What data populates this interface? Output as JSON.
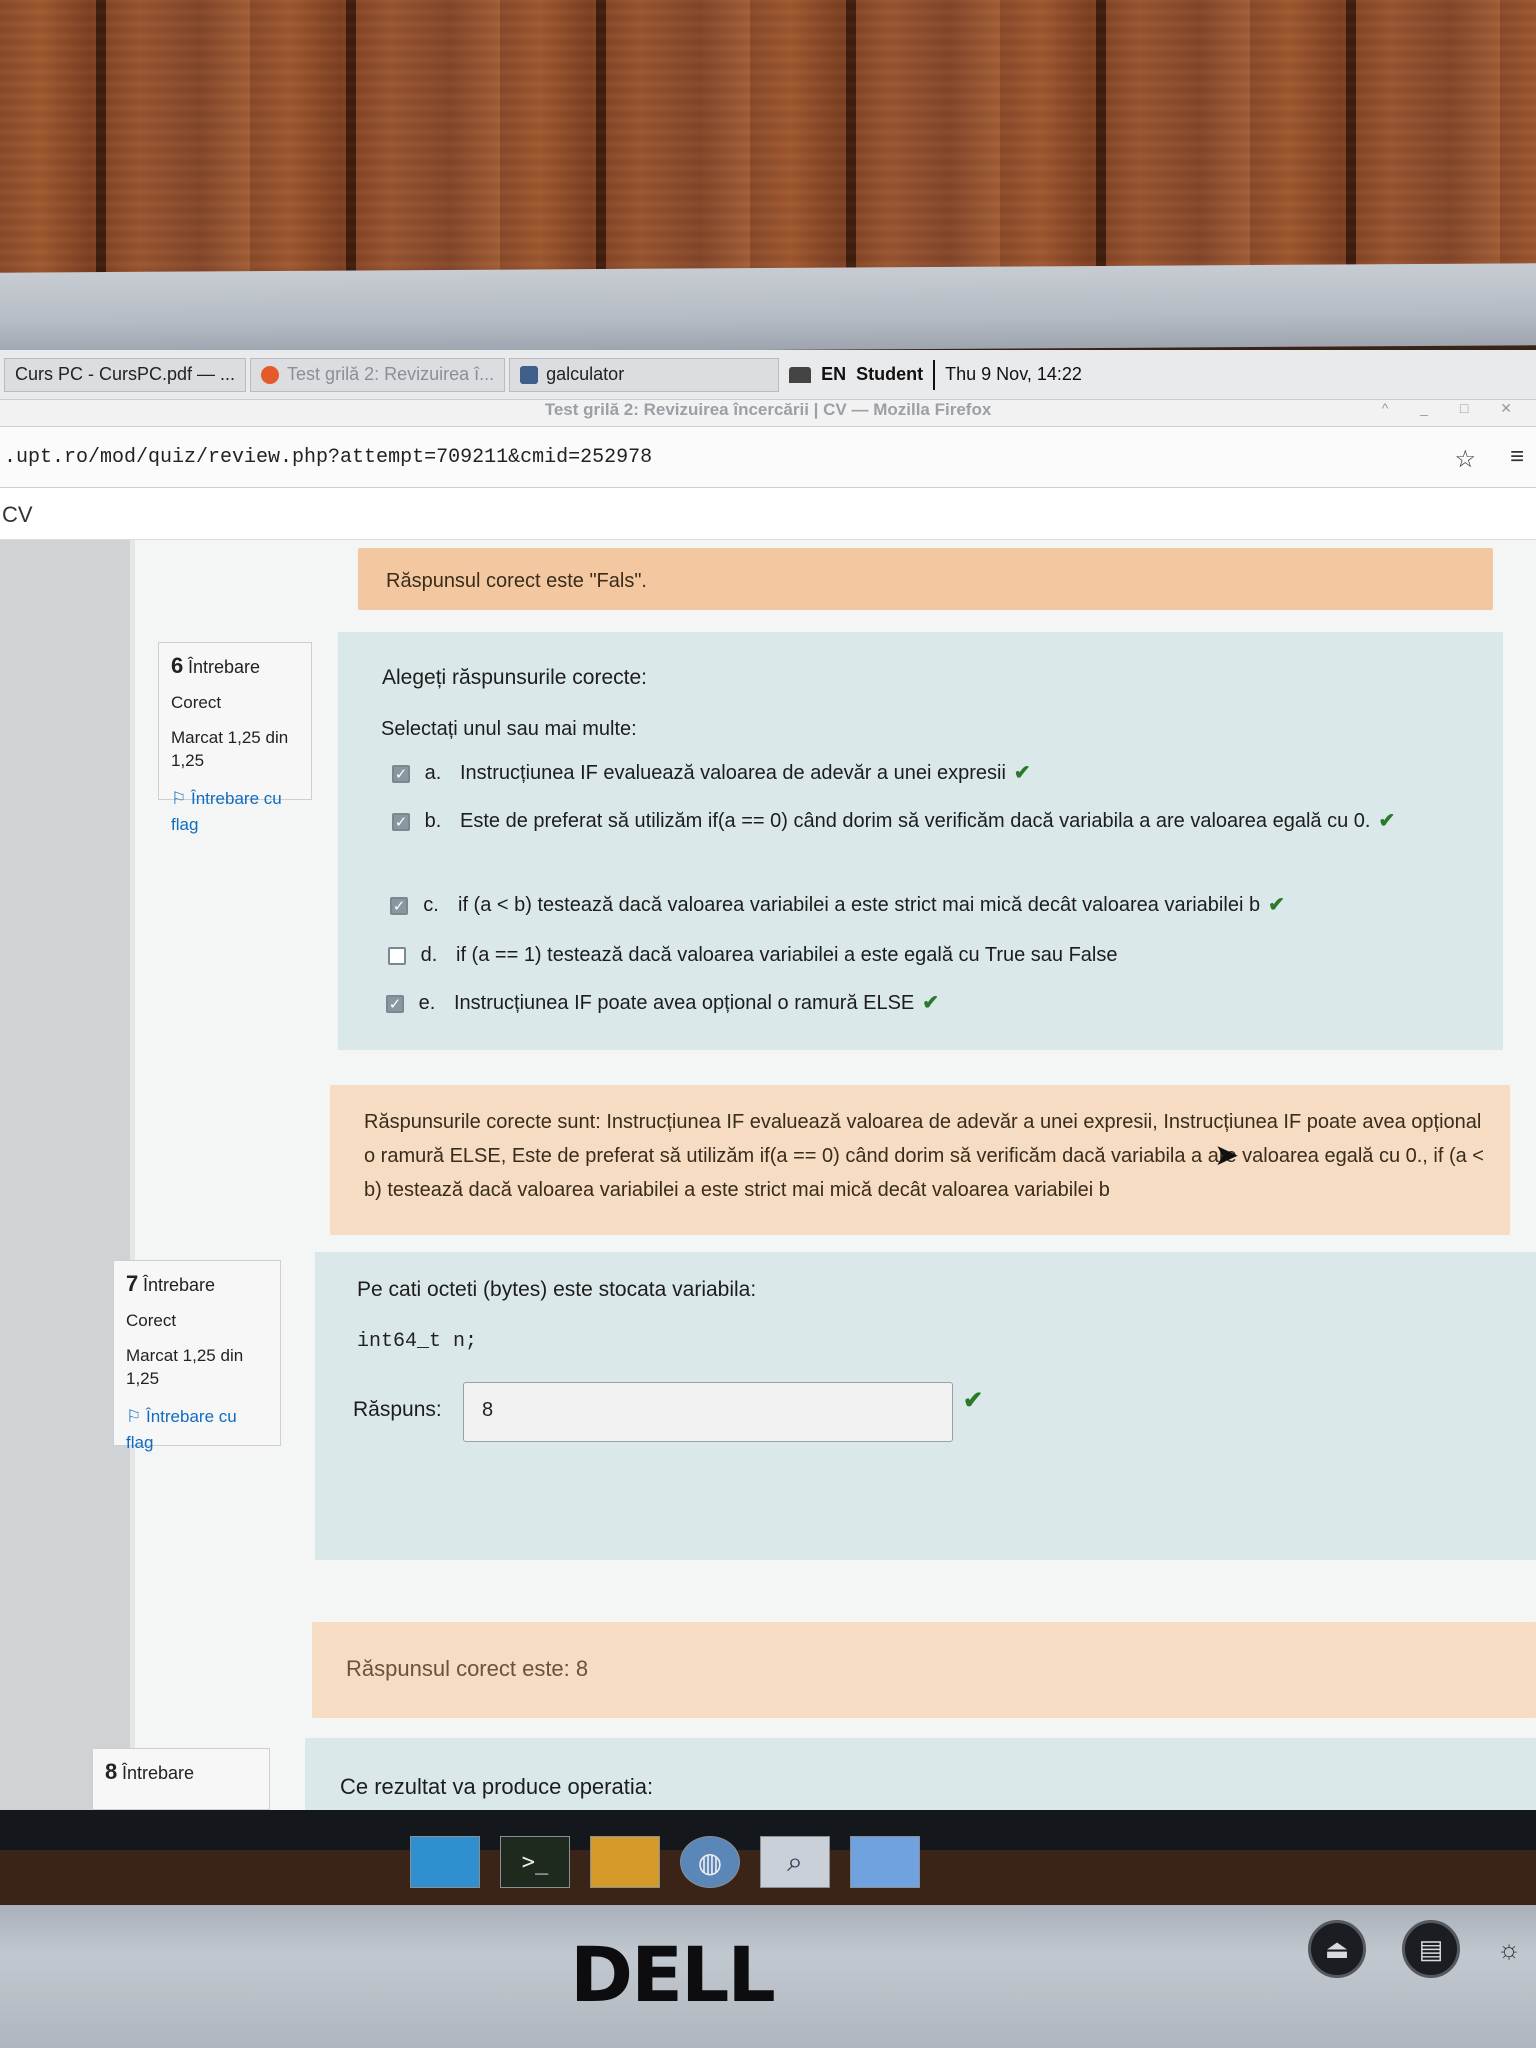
{
  "taskbar": {
    "tasks": [
      {
        "label": "Curs PC - CursPC.pdf — ..."
      },
      {
        "label": "Test grilă 2: Revizuirea î..."
      },
      {
        "label": "galculator"
      }
    ],
    "keyboard_layout": "EN",
    "user": "Student",
    "datetime": "Thu  9 Nov, 14:22"
  },
  "window": {
    "title": "Test grilă 2: Revizuirea încercării | CV — Mozilla Firefox"
  },
  "browser": {
    "url": ".upt.ro/mod/quiz/review.php?attempt=709211&cmid=252978",
    "breadcrumb": "CV"
  },
  "prev_feedback": "Răspunsul corect este \"Fals\".",
  "q6": {
    "number": "6",
    "word": "Întrebare",
    "status": "Corect",
    "mark": "Marcat 1,25 din 1,25",
    "flag": "Întrebare cu flag",
    "prompt": "Alegeți răspunsurile corecte:",
    "instruction": "Selectați unul sau mai multe:",
    "options": [
      {
        "letter": "a.",
        "text": "Instrucțiunea IF evaluează valoarea de adevăr a unei expresii",
        "checked": true
      },
      {
        "letter": "b.",
        "text": "Este de preferat să utilizăm if(a == 0) când dorim să verificăm dacă variabila a are valoarea egală cu 0.",
        "checked": true
      },
      {
        "letter": "c.",
        "text": "if (a < b) testează dacă valoarea variabilei a este strict mai mică decât valoarea variabilei b",
        "checked": true
      },
      {
        "letter": "d.",
        "text": "if (a == 1) testează dacă valoarea variabilei a este egală cu True sau False",
        "checked": false
      },
      {
        "letter": "e.",
        "text": "Instrucțiunea IF poate avea opțional o ramură ELSE",
        "checked": true
      }
    ],
    "feedback": "Răspunsurile corecte sunt: Instrucțiunea IF evaluează valoarea de adevăr a unei expresii, Instrucțiunea IF poate avea opțional o ramură ELSE, Este de preferat să utilizăm if(a == 0) când dorim să verificăm dacă variabila a are valoarea egală cu 0., if (a < b) testează dacă valoarea variabilei a este strict mai mică decât valoarea variabilei b"
  },
  "q7": {
    "number": "7",
    "word": "Întrebare",
    "status": "Corect",
    "mark": "Marcat 1,25 din 1,25",
    "flag": "Întrebare cu flag",
    "prompt": "Pe cati octeti (bytes) este stocata variabila:",
    "code": "int64_t n;",
    "answer_label": "Răspuns:",
    "answer_value": "8",
    "feedback": "Răspunsul corect este: 8"
  },
  "q8": {
    "number": "8",
    "word": "Întrebare",
    "prompt": "Ce rezultat va produce operatia:"
  },
  "monitor": {
    "brand": "DELL"
  },
  "colors": {
    "correct_tick": "#2b7a2b",
    "feedback_bg": "#f5dcc2",
    "formulation_bg": "#dbe8ea",
    "link": "#0f6cbf"
  }
}
